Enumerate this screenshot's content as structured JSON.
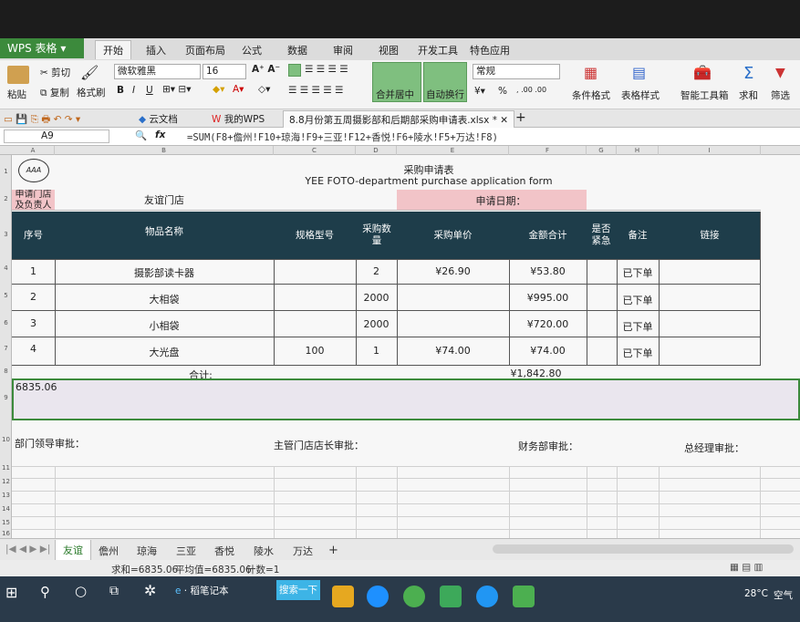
{
  "app": {
    "title": "WPS 表格"
  },
  "menu_tabs": [
    "开始",
    "插入",
    "页面布局",
    "公式",
    "数据",
    "审阅",
    "视图",
    "开发工具",
    "特色应用"
  ],
  "ribbon": {
    "paste": "粘贴",
    "cut": "剪切",
    "copy": "复制",
    "format_painter": "格式刷",
    "font": "微软雅黑",
    "font_size": "16",
    "merge_center": "合并居中",
    "wrap_text": "自动换行",
    "number_format": "常规",
    "cond_format": "条件格式",
    "table_style": "表格样式",
    "smart_toolbox": "智能工具箱",
    "sum": "求和",
    "filter": "筛选",
    "bold": "B",
    "italic": "I",
    "underline": "U",
    "percent": "%"
  },
  "doc_tabs": {
    "cloud": "云文档",
    "mywps": "我的WPS",
    "file": "8.8月份第五周摄影部和后期部采购申请表.xlsx *",
    "new_tab": "+"
  },
  "formula_bar": {
    "cell_ref": "A9",
    "fx": "fx",
    "formula": "=SUM(F8+儋州!F10+琼海!F9+三亚!F12+香悦!F6+陵水!F5+万达!F8)"
  },
  "columns": [
    "A",
    "B",
    "C",
    "D",
    "E",
    "F",
    "G",
    "H",
    "I"
  ],
  "rows": [
    "1",
    "2",
    "3",
    "4",
    "5",
    "6",
    "7",
    "8",
    "9",
    "10",
    "11",
    "12",
    "13",
    "14",
    "15",
    "16"
  ],
  "sheet": {
    "logo": "AAA",
    "title_cn": "采购申请表",
    "title_en": "YEE FOTO-department purchase application form",
    "store_label": "申请门店及负责人",
    "store_value": "友谊门店",
    "date_label": "申请日期：",
    "headers": [
      "序号",
      "物品名称",
      "规格型号",
      "采购数量",
      "采购单价",
      "金额合计",
      "是否紧急",
      "备注",
      "链接"
    ],
    "items": [
      {
        "no": "1",
        "name": "摄影部读卡器",
        "spec": "",
        "qty": "2",
        "price": "¥26.90",
        "total": "¥53.80",
        "urgent": "",
        "note": "已下单",
        "link": ""
      },
      {
        "no": "2",
        "name": "大相袋",
        "spec": "",
        "qty": "2000",
        "price": "",
        "total": "¥995.00",
        "urgent": "",
        "note": "已下单",
        "link": ""
      },
      {
        "no": "3",
        "name": "小相袋",
        "spec": "",
        "qty": "2000",
        "price": "",
        "total": "¥720.00",
        "urgent": "",
        "note": "已下单",
        "link": ""
      },
      {
        "no": "4",
        "name": "大光盘",
        "spec": "100",
        "qty": "1",
        "price": "¥74.00",
        "total": "¥74.00",
        "urgent": "",
        "note": "已下单",
        "link": ""
      }
    ],
    "subtotal_label": "合计:",
    "subtotal_value": "¥1,842.80",
    "grand_total": "6835.06",
    "approvals": [
      "部门领导审批：",
      "主管门店店长审批：",
      "财务部审批：",
      "总经理审批："
    ]
  },
  "sheet_tabs": [
    "友谊",
    "儋州",
    "琼海",
    "三亚",
    "香悦",
    "陵水",
    "万达",
    "+"
  ],
  "status": {
    "sum": "求和=6835.06",
    "avg": "平均值=6835.06",
    "count": "计数=1"
  },
  "taskbar": {
    "notebook": "稻笔记本",
    "search_btn": "搜索一下",
    "temp": "28°C",
    "weather": "空气"
  },
  "colors": {
    "header_dark": "#1e3d4a",
    "pink": "#f2c4c8",
    "wps_green": "#3c8a3c",
    "ribbon_green": "#7fbf7f"
  }
}
